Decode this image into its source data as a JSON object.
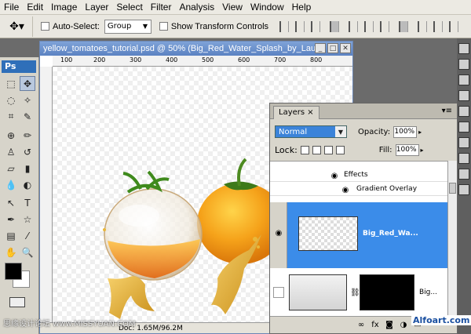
{
  "menu": [
    "File",
    "Edit",
    "Image",
    "Layer",
    "Select",
    "Filter",
    "Analysis",
    "View",
    "Window",
    "Help"
  ],
  "options": {
    "auto_select_label": "Auto-Select:",
    "auto_select_value": "Group",
    "show_transform_label": "Show Transform Controls"
  },
  "toolbox": {
    "logo": "Ps"
  },
  "document": {
    "title": "yellow_tomatoes_tutorial.psd @ 50% (Big_Red_Water_Splash_by_Laur...",
    "ruler_ticks": [
      "100",
      "200",
      "300",
      "400",
      "500",
      "600",
      "700",
      "800"
    ],
    "status": "Doc: 1.65M/96.2M"
  },
  "layers_panel": {
    "tab": "Layers",
    "blend_mode": "Normal",
    "opacity_label": "Opacity:",
    "opacity_value": "100%",
    "lock_label": "Lock:",
    "fill_label": "Fill:",
    "fill_value": "100%",
    "effects_label": "Effects",
    "gradient_overlay_label": "Gradient Overlay",
    "selected_layer_name": "Big_Red_Wa...",
    "second_layer_name": "Big..."
  },
  "watermarks": {
    "left": "思缘设计论坛 www.MISSYUAN.COM",
    "right": "Alfoart.com"
  },
  "colors": {
    "selection_blue": "#3b8ce9",
    "title_blue": "#5b82c2",
    "foreground": "#000000",
    "background": "#ffffff"
  }
}
